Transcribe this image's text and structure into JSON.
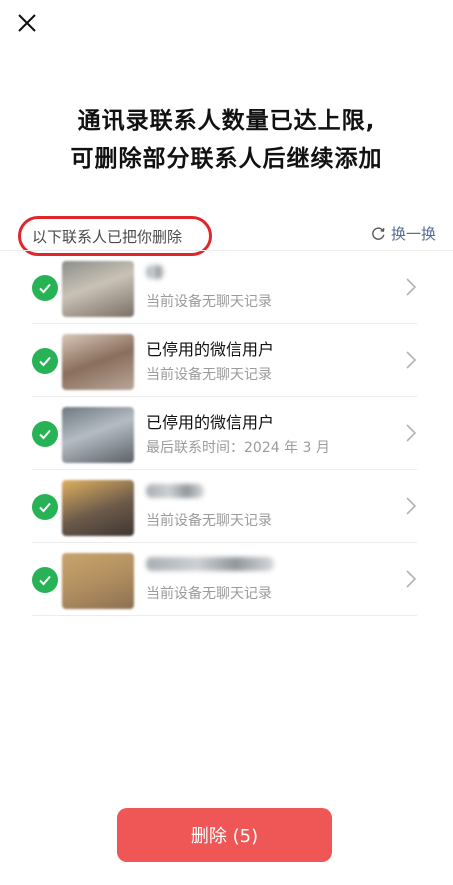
{
  "header": {
    "title_line1": "通讯录联系人数量已达上限,",
    "title_line2": "可删除部分联系人后继续添加"
  },
  "section": {
    "label": "以下联系人已把你删除",
    "refresh_label": "换一换"
  },
  "contacts": [
    {
      "name": "",
      "status": "当前设备无聊天记录",
      "checked": true
    },
    {
      "name": "已停用的微信用户",
      "status": "当前设备无聊天记录",
      "checked": true
    },
    {
      "name": "已停用的微信用户",
      "status": "最后联系时间：2024 年 3 月",
      "checked": true
    },
    {
      "name": "",
      "status": "当前设备无聊天记录",
      "checked": true
    },
    {
      "name": "",
      "status": "当前设备无聊天记录",
      "checked": true
    }
  ],
  "footer": {
    "delete_label": "删除 (5)"
  },
  "colors": {
    "accent_green": "#27b355",
    "delete_red": "#ef5656",
    "highlight_red": "#e0262b",
    "link_blue": "#576b95"
  }
}
